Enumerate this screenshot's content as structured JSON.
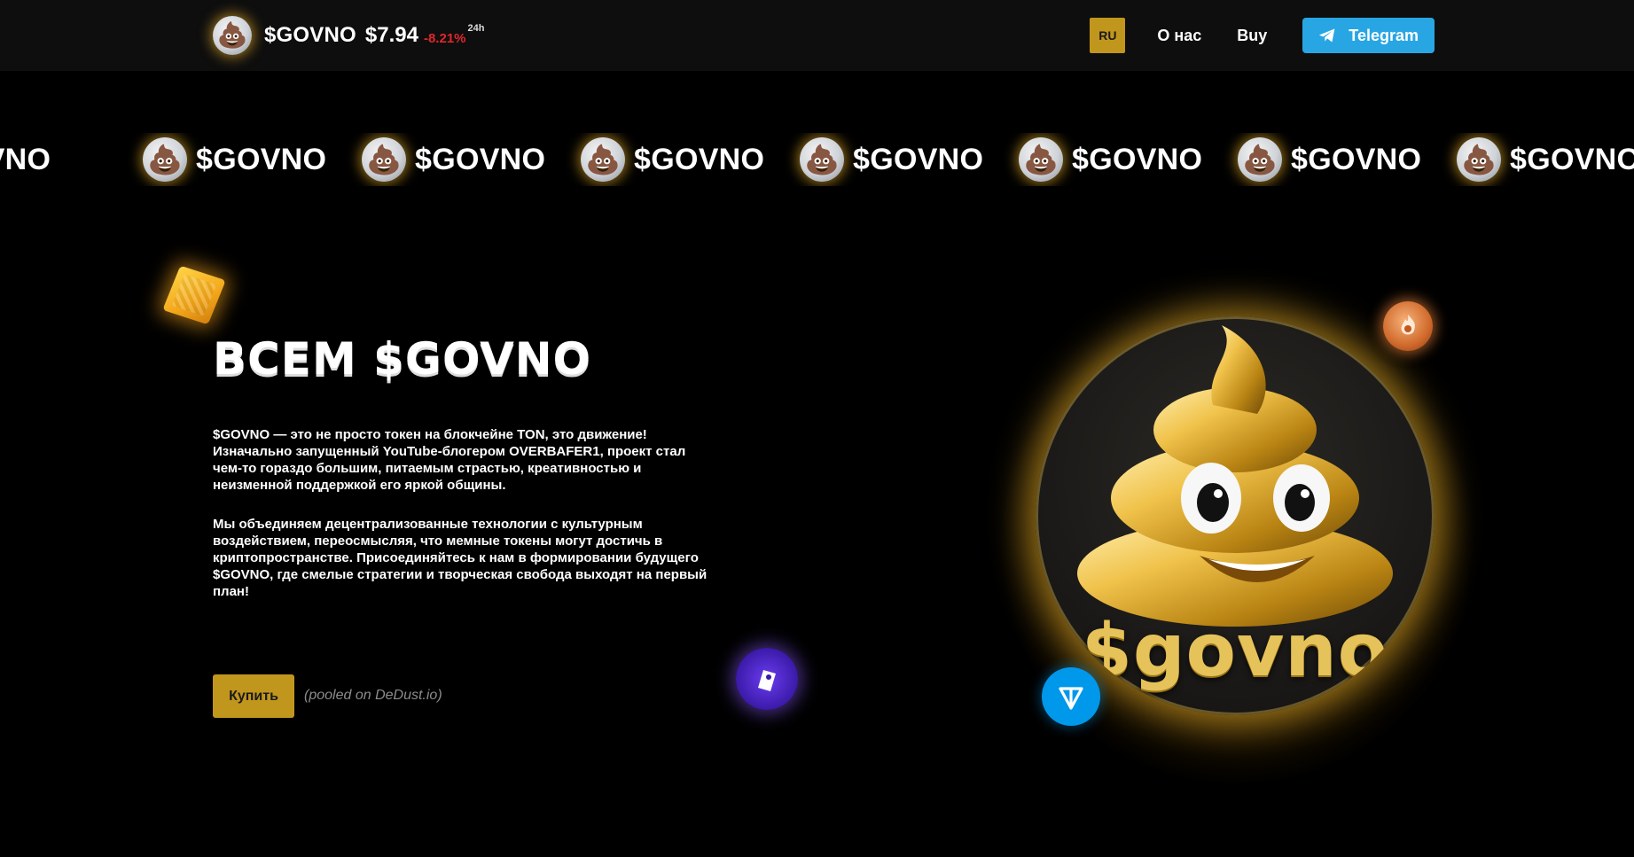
{
  "header": {
    "logo_icon": "poop-emoji-coin",
    "logo_glyph": "💩",
    "token_name": "$GOVNO",
    "price": "$7.94",
    "change": "-8.21%",
    "change_period": "24h",
    "change_color": "#e0272b",
    "nav": {
      "lang": "RU",
      "about": "О нас",
      "buy": "Buy",
      "telegram": "Telegram"
    }
  },
  "marquee": {
    "items": [
      "$GOVNO",
      "$GOVNO",
      "$GOVNO",
      "$GOVNO",
      "$GOVNO",
      "$GOVNO",
      "$GOVNO",
      "$GOVNO"
    ]
  },
  "hero": {
    "title": "ВСЕМ $GOVNO",
    "paragraph_1": "$GOVNO — это не просто токен на блокчейне TON, это движение! Изначально запущенный YouTube-блогером OVERBAFER1, проект стал чем-то гораздо большим, питаемым страстью, креативностью и неизменной поддержкой его яркой общины.",
    "paragraph_2": "Мы объединяем децентрализованные технологии с культурным воздействием, переосмысляя, что мемные токены могут достичь в криптопространстве. Присоединяйтесь к нам в формировании будущего $GOVNO, где смелые стратегии и творческая свобода выходят на первый план!",
    "buy_button": "Купить",
    "pooled_note": "(pooled on DeDust.io)",
    "mascot_label": "$govno"
  },
  "colors": {
    "background": "#000000",
    "header_bg": "#0e0e0e",
    "accent_gold": "#c1961c",
    "telegram_blue": "#28a6e3",
    "ton_blue": "#0098ea"
  }
}
